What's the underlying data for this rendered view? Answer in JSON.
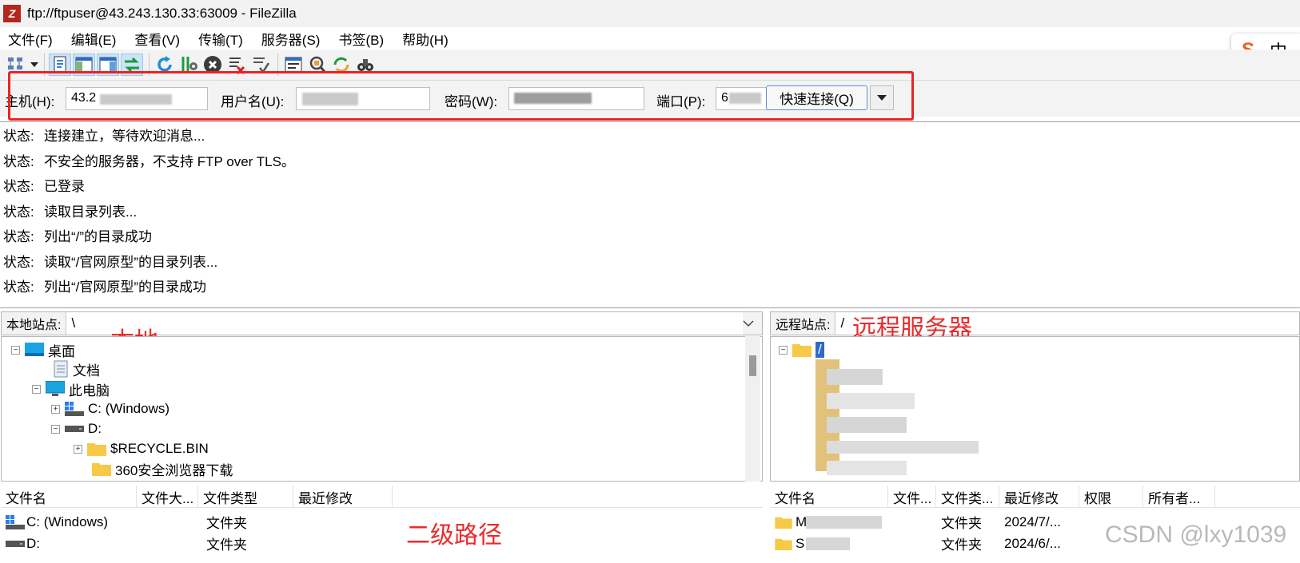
{
  "window": {
    "title": "ftp://ftpuser@43.243.130.33:63009 - FileZilla"
  },
  "menu": [
    "文件(F)",
    "编辑(E)",
    "查看(V)",
    "传输(T)",
    "服务器(S)",
    "书签(B)",
    "帮助(H)"
  ],
  "ime": {
    "logo": "S",
    "mode": "中"
  },
  "toolbar": {
    "icons": [
      "site-manager-icon",
      "toggle-log-icon",
      "toggle-local-tree-icon",
      "toggle-remote-tree-icon",
      "toggle-transfer-queue-icon",
      "refresh-icon",
      "process-queue-icon",
      "cancel-icon",
      "disconnect-icon",
      "reconnect-icon",
      "directory-listing-filter-icon",
      "compare-directories-icon",
      "sync-browsing-icon",
      "search-remote-icon"
    ]
  },
  "quickconnect": {
    "host_label": "主机(H):",
    "host_value": "43.2",
    "user_label": "用户名(U):",
    "user_value": "",
    "pass_label": "密码(W):",
    "pass_value": "",
    "port_label": "端口(P):",
    "port_value": "6",
    "connect_label": "快速连接(Q)",
    "highlight_color": "#ee2222"
  },
  "status_log": [
    {
      "key": "状态:",
      "text": "连接建立，等待欢迎消息..."
    },
    {
      "key": "状态:",
      "text": "不安全的服务器，不支持 FTP over TLS。"
    },
    {
      "key": "状态:",
      "text": "已登录"
    },
    {
      "key": "状态:",
      "text": "读取目录列表..."
    },
    {
      "key": "状态:",
      "text": "列出“/”的目录成功"
    },
    {
      "key": "状态:",
      "text": "读取“/官网原型”的目录列表..."
    },
    {
      "key": "状态:",
      "text": "列出“/官网原型”的目录成功"
    }
  ],
  "local": {
    "label": "本地站点:",
    "path": "\\",
    "annotation": "本地",
    "tree": [
      {
        "label": "桌面",
        "expander": "−"
      },
      {
        "label": "文档",
        "expander": ""
      },
      {
        "label": "此电脑",
        "expander": "−"
      },
      {
        "label": "C: (Windows)",
        "expander": "+"
      },
      {
        "label": "D:",
        "expander": "−"
      },
      {
        "label": "$RECYCLE.BIN",
        "expander": "+"
      },
      {
        "label": "360安全浏览器下载",
        "expander": ""
      }
    ],
    "columns": [
      "文件名",
      "文件大...",
      "文件类型",
      "最近修改"
    ],
    "rows": [
      {
        "name": "C: (Windows)",
        "size": "",
        "type": "文件夹",
        "modified": ""
      },
      {
        "name": "D:",
        "size": "",
        "type": "文件夹",
        "modified": ""
      }
    ],
    "annotation_list": "二级路径"
  },
  "remote": {
    "label": "远程站点:",
    "path": "/",
    "annotation": "远程服务器",
    "tree_root": "/",
    "columns": [
      "文件名",
      "文件...",
      "文件类...",
      "最近修改",
      "权限",
      "所有者..."
    ],
    "rows": [
      {
        "name": "M",
        "size": "",
        "type": "文件夹",
        "modified": "2024/7/..."
      },
      {
        "name": "S",
        "size": "",
        "type": "文件夹",
        "modified": "2024/6/..."
      }
    ]
  },
  "watermark": "CSDN @lxy1039",
  "annotation_color": "#e82c2c"
}
